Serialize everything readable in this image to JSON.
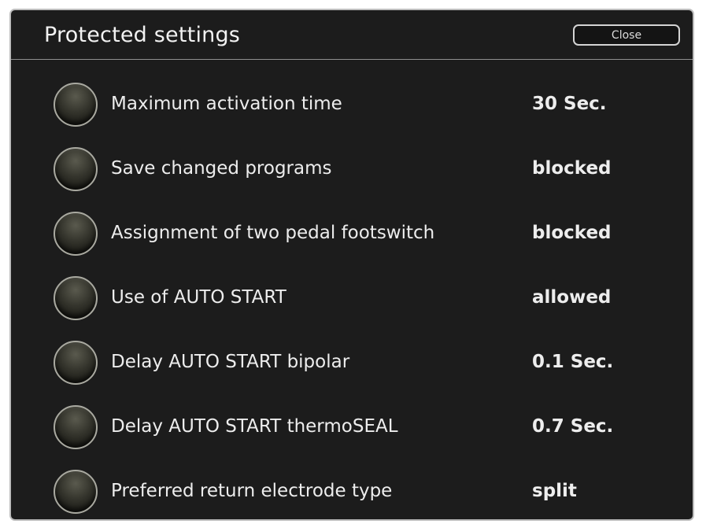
{
  "dialog": {
    "title": "Protected settings",
    "close_label": "Close"
  },
  "settings": [
    {
      "label": "Maximum activation time",
      "value": "30 Sec."
    },
    {
      "label": "Save changed programs",
      "value": "blocked"
    },
    {
      "label": "Assignment of two pedal footswitch",
      "value": "blocked"
    },
    {
      "label": "Use of AUTO START",
      "value": "allowed"
    },
    {
      "label": "Delay AUTO START bipolar",
      "value": "0.1 Sec."
    },
    {
      "label": "Delay AUTO START thermoSEAL",
      "value": "0.7 Sec."
    },
    {
      "label": "Preferred return electrode type",
      "value": "split"
    }
  ]
}
